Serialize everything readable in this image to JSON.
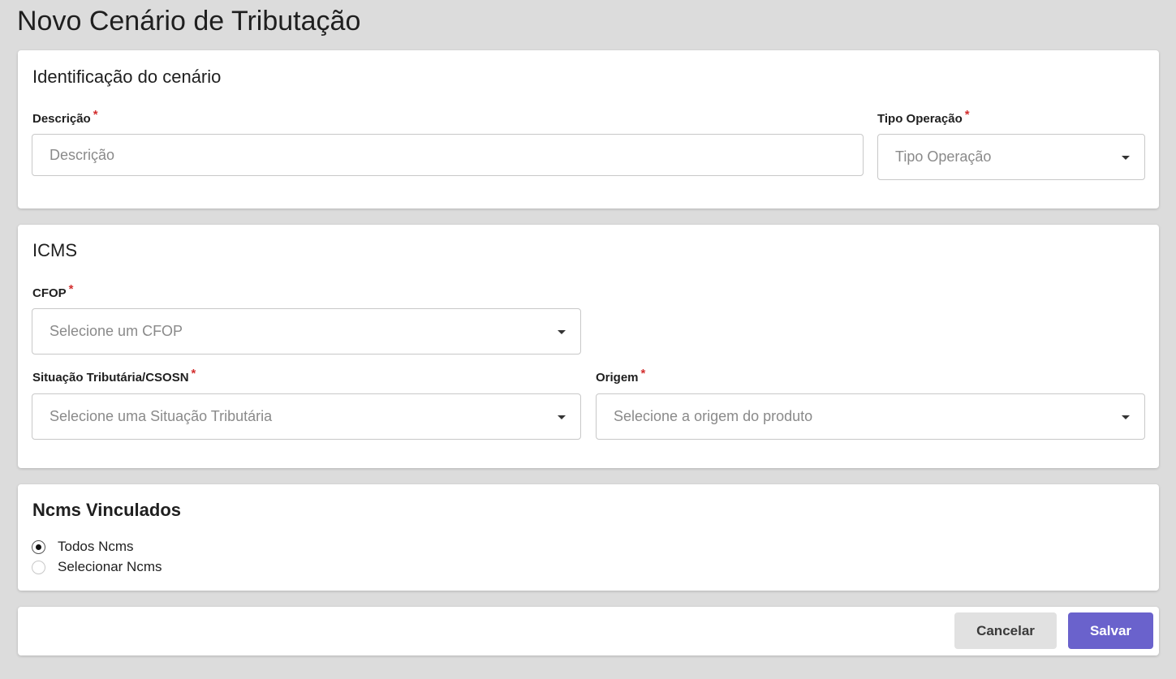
{
  "page": {
    "title": "Novo Cenário de Tributação"
  },
  "identificacao": {
    "title": "Identificação do cenário",
    "descricao": {
      "label": "Descrição",
      "required_mark": "*",
      "placeholder": "Descrição",
      "value": ""
    },
    "tipo_operacao": {
      "label": "Tipo Operação",
      "required_mark": "*",
      "placeholder": "Tipo Operação"
    }
  },
  "icms": {
    "title": "ICMS",
    "cfop": {
      "label": "CFOP",
      "required_mark": "*",
      "placeholder": "Selecione um CFOP"
    },
    "situacao": {
      "label": "Situação Tributária/CSOSN",
      "required_mark": "*",
      "placeholder": "Selecione uma Situação Tributária"
    },
    "origem": {
      "label": "Origem",
      "required_mark": "*",
      "placeholder": "Selecione a origem do produto"
    }
  },
  "ncms": {
    "title": "Ncms Vinculados",
    "options": [
      {
        "label": "Todos Ncms",
        "checked": true
      },
      {
        "label": "Selecionar Ncms",
        "checked": false
      }
    ]
  },
  "actions": {
    "cancel_label": "Cancelar",
    "save_label": "Salvar"
  },
  "colors": {
    "required": "#d32f2f",
    "primary": "#6a62cc",
    "background": "#dcdcdc"
  },
  "icons": {
    "dropdown": "caret-down-icon"
  }
}
